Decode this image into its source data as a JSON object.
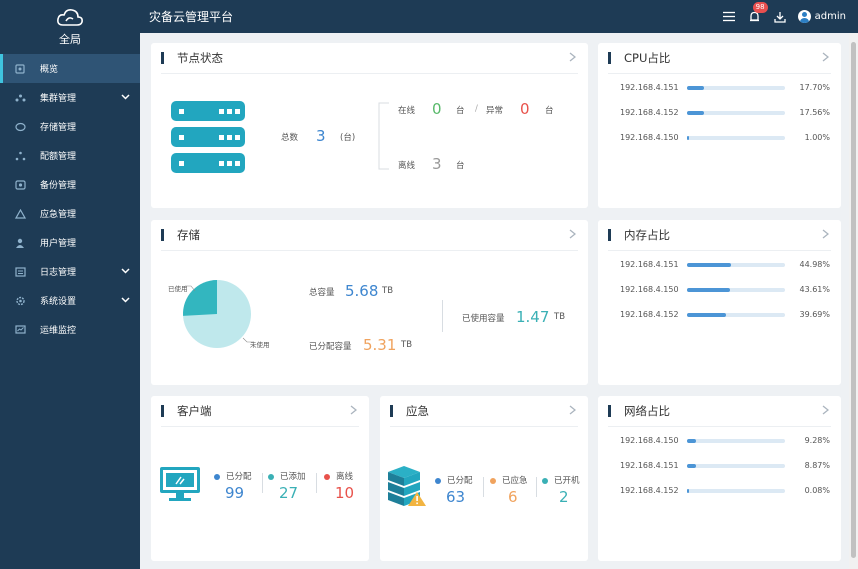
{
  "app": {
    "logo_text": "全局",
    "title": "灾备云管理平台",
    "notif_count": "98",
    "username": "admin"
  },
  "sidebar": {
    "items": [
      {
        "label": "概览",
        "icon": "dashboard-icon"
      },
      {
        "label": "集群管理",
        "icon": "cluster-icon",
        "expandable": true
      },
      {
        "label": "存储管理",
        "icon": "storage-icon"
      },
      {
        "label": "配额管理",
        "icon": "quota-icon"
      },
      {
        "label": "备份管理",
        "icon": "backup-icon"
      },
      {
        "label": "应急管理",
        "icon": "emergency-icon"
      },
      {
        "label": "用户管理",
        "icon": "user-icon"
      },
      {
        "label": "日志管理",
        "icon": "log-icon",
        "expandable": true
      },
      {
        "label": "系统设置",
        "icon": "settings-icon",
        "expandable": true
      },
      {
        "label": "运维监控",
        "icon": "monitor-icon"
      }
    ]
  },
  "node": {
    "title": "节点状态",
    "total_label": "总数",
    "total": "3",
    "total_unit": "(台)",
    "online_label": "在线",
    "online": "0",
    "unit": "台",
    "sep": "/",
    "abnormal_label": "异常",
    "abnormal": "0",
    "offline_label": "离线",
    "offline": "3"
  },
  "cpu": {
    "title": "CPU占比",
    "rows": [
      {
        "ip": "192.168.4.151",
        "pct": "17.70%",
        "value": 17.7
      },
      {
        "ip": "192.168.4.152",
        "pct": "17.56%",
        "value": 17.56
      },
      {
        "ip": "192.168.4.150",
        "pct": "1.00%",
        "value": 1.0
      }
    ]
  },
  "storage": {
    "title": "存储",
    "used_label": "已使用",
    "unused_label": "未使用",
    "total_label": "总容量",
    "total": "5.68",
    "unit": "TB",
    "allocated_label": "已分配容量",
    "allocated": "5.31",
    "usedcap_label": "已使用容量",
    "usedcap": "1.47",
    "pie": {
      "used": 1.47,
      "total": 5.68
    }
  },
  "memory": {
    "title": "内存占比",
    "rows": [
      {
        "ip": "192.168.4.151",
        "pct": "44.98%",
        "value": 44.98
      },
      {
        "ip": "192.168.4.150",
        "pct": "43.61%",
        "value": 43.61
      },
      {
        "ip": "192.168.4.152",
        "pct": "39.69%",
        "value": 39.69
      }
    ]
  },
  "client": {
    "title": "客户端",
    "assigned_label": "已分配",
    "assigned": "99",
    "added_label": "已添加",
    "added": "27",
    "offline_label": "离线",
    "offline": "10"
  },
  "emergency": {
    "title": "应急",
    "assigned_label": "已分配",
    "assigned": "63",
    "emergency_label": "已应急",
    "emergency": "6",
    "poweron_label": "已开机",
    "poweron": "2"
  },
  "network": {
    "title": "网络占比",
    "rows": [
      {
        "ip": "192.168.4.150",
        "pct": "9.28%",
        "value": 9.28
      },
      {
        "ip": "192.168.4.151",
        "pct": "8.87%",
        "value": 8.87
      },
      {
        "ip": "192.168.4.152",
        "pct": "0.08%",
        "value": 0.08
      }
    ]
  },
  "colors": {
    "sidebar": "#1e3b55",
    "green": "#58b96a",
    "red": "#e8524b",
    "blue": "#3e86cf",
    "teal": "#3ab0b5",
    "orange": "#f0a35e",
    "bar_fill": "#4c95d6",
    "pie_used": "#33b6bf",
    "pie_free": "#bfe8ec"
  }
}
